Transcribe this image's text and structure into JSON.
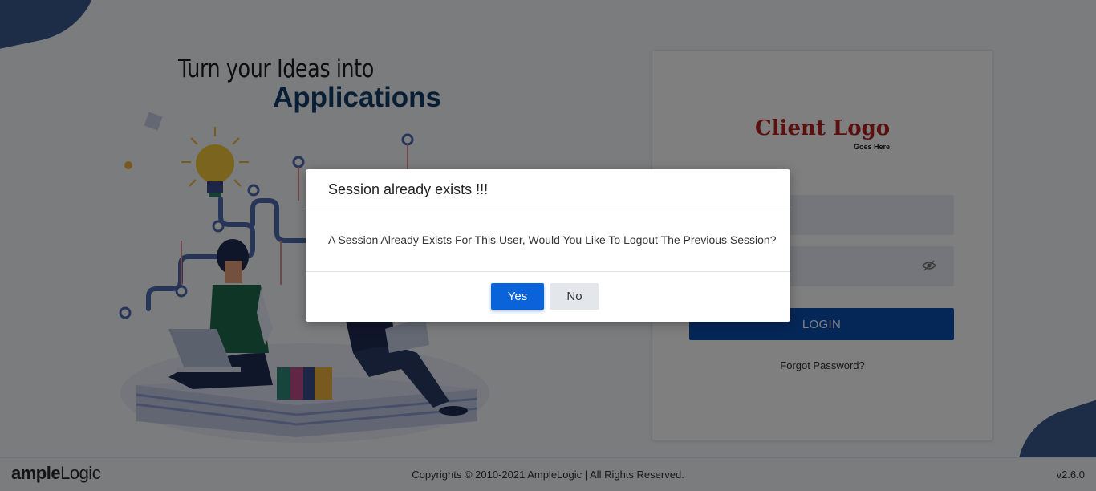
{
  "hero": {
    "tagline_line1": "Turn your Ideas into",
    "tagline_line2": "Applications"
  },
  "login": {
    "client_logo_text": "Client Logo",
    "client_logo_subtext": "Goes Here",
    "username_value": "",
    "password_value": "",
    "login_button": "LOGIN",
    "forgot_password": "Forgot Password?"
  },
  "footer": {
    "brand_strong": "ample",
    "brand_light": "Logic",
    "copyright": "Copyrights © 2010-2021 AmpleLogic | All Rights Reserved.",
    "version": "v2.6.0"
  },
  "modal": {
    "title": "Session already exists !!!",
    "message": "A Session Already Exists For This User, Would You Like To Logout The Previous Session?",
    "yes_label": "Yes",
    "no_label": "No"
  },
  "colors": {
    "primary": "#0a63d8",
    "login_button": "#0a4fb0",
    "tagline_accent": "#0f3c68",
    "client_logo": "#b3201e"
  }
}
